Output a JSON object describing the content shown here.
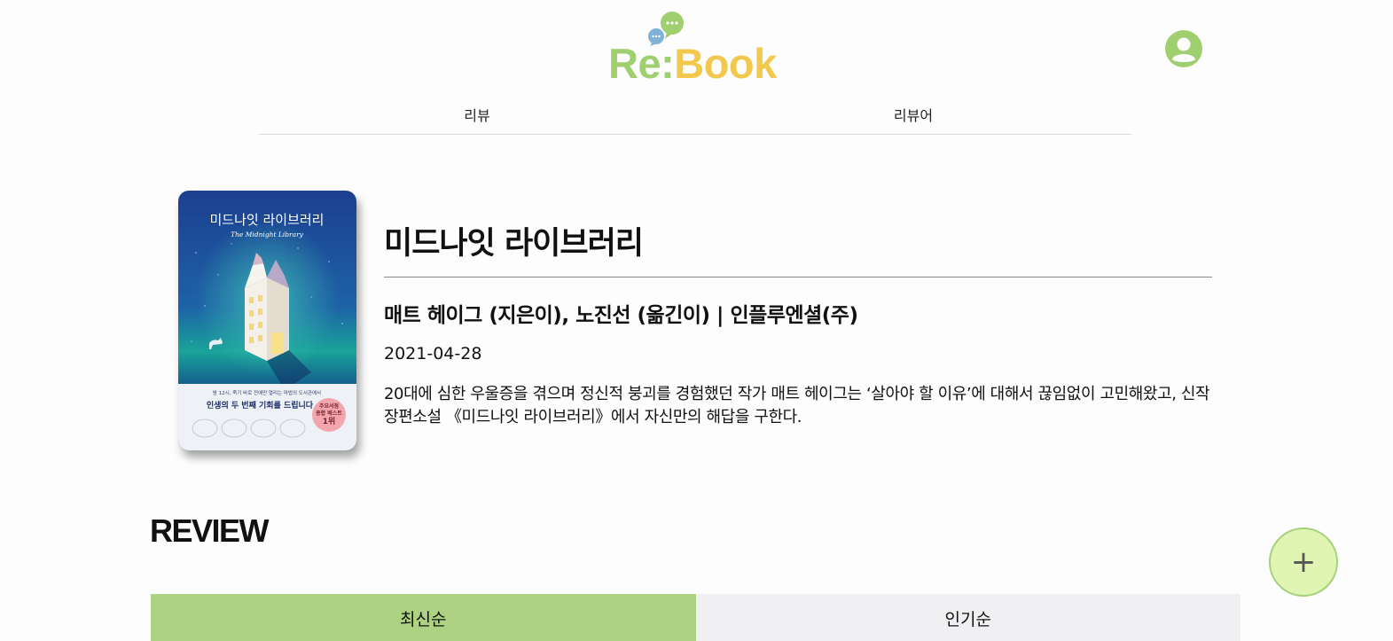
{
  "header": {
    "logo": {
      "re": "Re",
      "colon": ":",
      "book": "Book"
    }
  },
  "nav": {
    "items": [
      {
        "label": "리뷰"
      },
      {
        "label": "리뷰어"
      }
    ]
  },
  "book": {
    "cover": {
      "title_kr": "미드나잇 라이브러리",
      "title_en": "The Midnight Library",
      "tagline": "밤 12시, 죽기 바로 전에만 열리는 마법의 도서관에서",
      "headline": "인생의 두 번째 기회를 드립니다",
      "badge": "주요서점 종합 베스트 1위"
    },
    "title": "미드나잇 라이브러리",
    "authors": "매트 헤이그 (지은이), 노진선 (옮긴이) | 인플루엔셜(주)",
    "date": "2021-04-28",
    "description": "20대에 심한 우울증을 겪으며 정신적 붕괴를 경험했던 작가 매트 헤이그는 ‘살아야 할 이유’에 대해서 끊임없이 고민해왔고, 신작 장편소설 《미드나잇 라이브러리》에서 자신만의 해답을 구한다."
  },
  "review": {
    "heading": "REVIEW",
    "tabs": [
      {
        "label": "최신순",
        "active": true
      },
      {
        "label": "인기순",
        "active": false
      }
    ]
  },
  "fab": {
    "label": "+"
  },
  "colors": {
    "brand_green": "#9fcf6e",
    "brand_yellow": "#f2c94c",
    "active_tab": "#acd282",
    "inactive_tab": "#f0f0f2",
    "fab_bg": "#e0f5b4"
  },
  "icons": {
    "avatar": "user-circle-icon",
    "logo_bubbles": "chat-bubbles-icon",
    "fab": "plus-icon"
  }
}
